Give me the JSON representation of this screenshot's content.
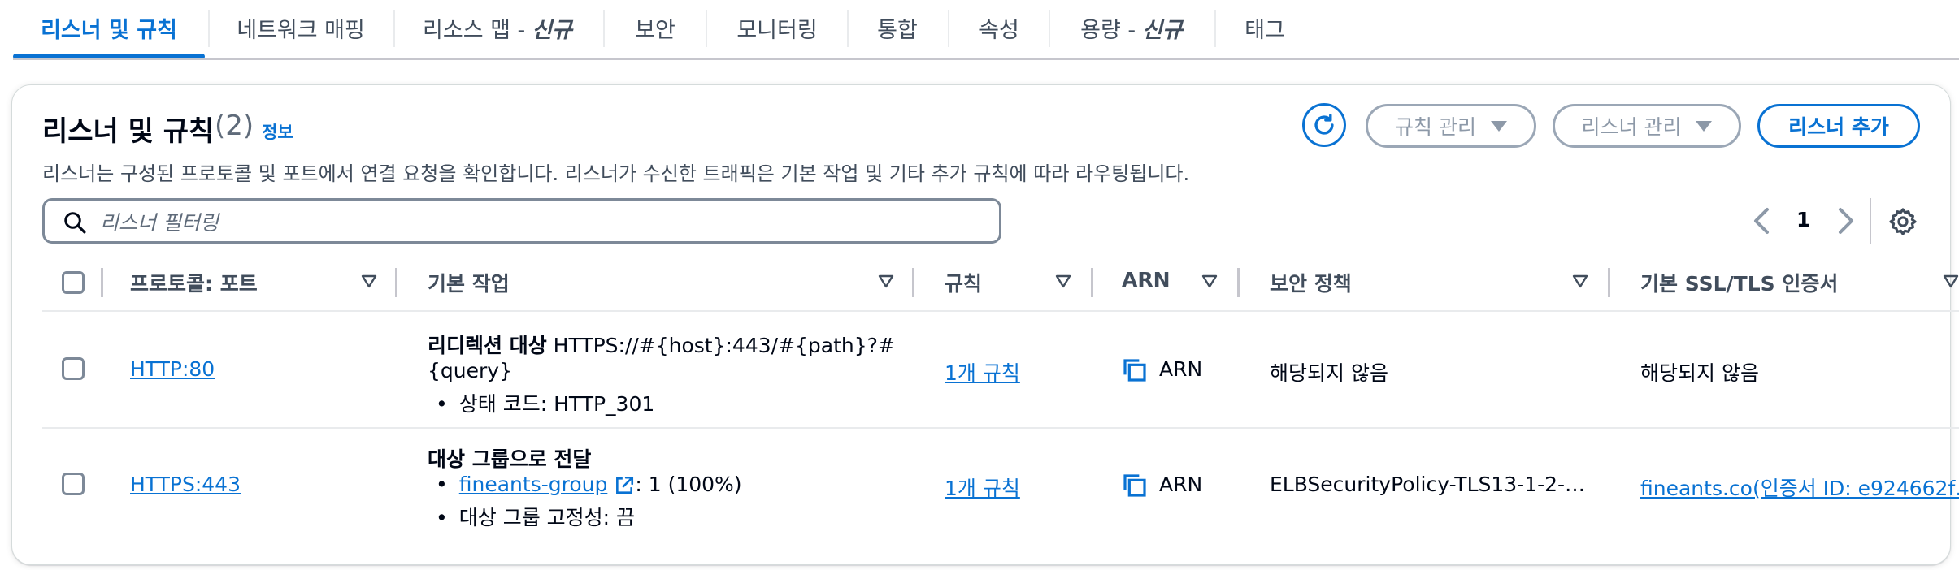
{
  "tabs": [
    {
      "label": "리스너 및 규칙"
    },
    {
      "label": "네트워크 매핑"
    },
    {
      "label": "리소스 맵 -",
      "badge": "신규"
    },
    {
      "label": "보안"
    },
    {
      "label": "모니터링"
    },
    {
      "label": "통합"
    },
    {
      "label": "속성"
    },
    {
      "label": "용량 -",
      "badge": "신규"
    },
    {
      "label": "태그"
    }
  ],
  "header": {
    "title": "리스너 및 규칙",
    "count": "(2)",
    "info": "정보",
    "description": "리스너는 구성된 프로토콜 및 포트에서 연결 요청을 확인합니다. 리스너가 수신한 트래픽은 기본 작업 및 기타 추가 규칙에 따라 라우팅됩니다."
  },
  "actions": {
    "manage_rules": "규칙 관리",
    "manage_listeners": "리스너 관리",
    "add_listener": "리스너 추가"
  },
  "search": {
    "placeholder": "리스너 필터링",
    "value": ""
  },
  "pagination": {
    "current_page": "1"
  },
  "table": {
    "columns": [
      "프로토콜: 포트",
      "기본 작업",
      "규칙",
      "ARN",
      "보안 정책",
      "기본 SSL/TLS 인증서"
    ],
    "rows": [
      {
        "protocol_port": "HTTP:80",
        "action_title": "리디렉션 대상",
        "action_target_1": "HTTPS://#{host}:443/#{path}?#",
        "action_target_2": "{query}",
        "action_detail": "상태 코드: HTTP_301",
        "rules": "1개 규칙",
        "arn": "ARN",
        "security_policy": "해당되지 않음",
        "certificate": "해당되지 않음"
      },
      {
        "protocol_port": "HTTPS:443",
        "action_title": "대상 그룹으로 전달",
        "target_group": "fineants-group",
        "target_weight": ": 1 (100%)",
        "action_detail": "대상 그룹 고정성: 끔",
        "rules": "1개 규칙",
        "arn": "ARN",
        "security_policy": "ELBSecurityPolicy-TLS13-1-2-…",
        "certificate": "fineants.co(인증서 ID: e924662f…"
      }
    ]
  },
  "colors": {
    "accent": "#0972d3",
    "text": "#000716",
    "muted": "#414d5c",
    "border": "#7d8998"
  },
  "icons": [
    "refresh-icon",
    "caret-down-icon",
    "search-icon",
    "chevron-left-icon",
    "chevron-right-icon",
    "settings-icon",
    "sort-icon",
    "copy-icon",
    "external-link-icon"
  ]
}
